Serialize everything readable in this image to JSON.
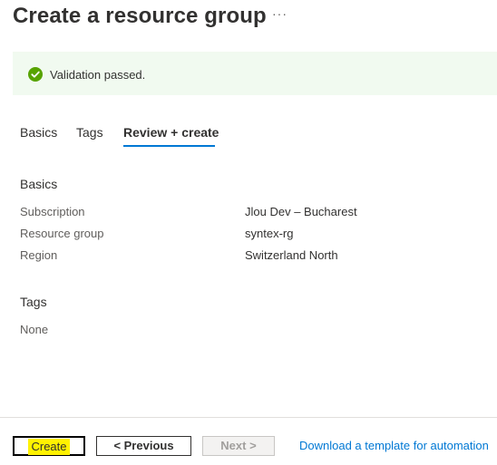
{
  "header": {
    "title": "Create a resource group",
    "more_label": "···"
  },
  "banner": {
    "icon": "check-circle-icon",
    "text": "Validation passed.",
    "status_color": "#57a300"
  },
  "tabs": [
    {
      "label": "Basics",
      "active": false
    },
    {
      "label": "Tags",
      "active": false
    },
    {
      "label": "Review + create",
      "active": true
    }
  ],
  "basics": {
    "heading": "Basics",
    "rows": [
      {
        "label": "Subscription",
        "value": "Jlou Dev – Bucharest"
      },
      {
        "label": "Resource group",
        "value": "syntex-rg"
      },
      {
        "label": "Region",
        "value": "Switzerland North"
      }
    ]
  },
  "tags_section": {
    "heading": "Tags",
    "value": "None"
  },
  "footer": {
    "create_label": "Create",
    "previous_label": "< Previous",
    "next_label": "Next >",
    "download_link": "Download a template for automation"
  },
  "colors": {
    "accent": "#0078d4",
    "banner_bg": "#f1faf0",
    "highlight": "#fff200"
  }
}
